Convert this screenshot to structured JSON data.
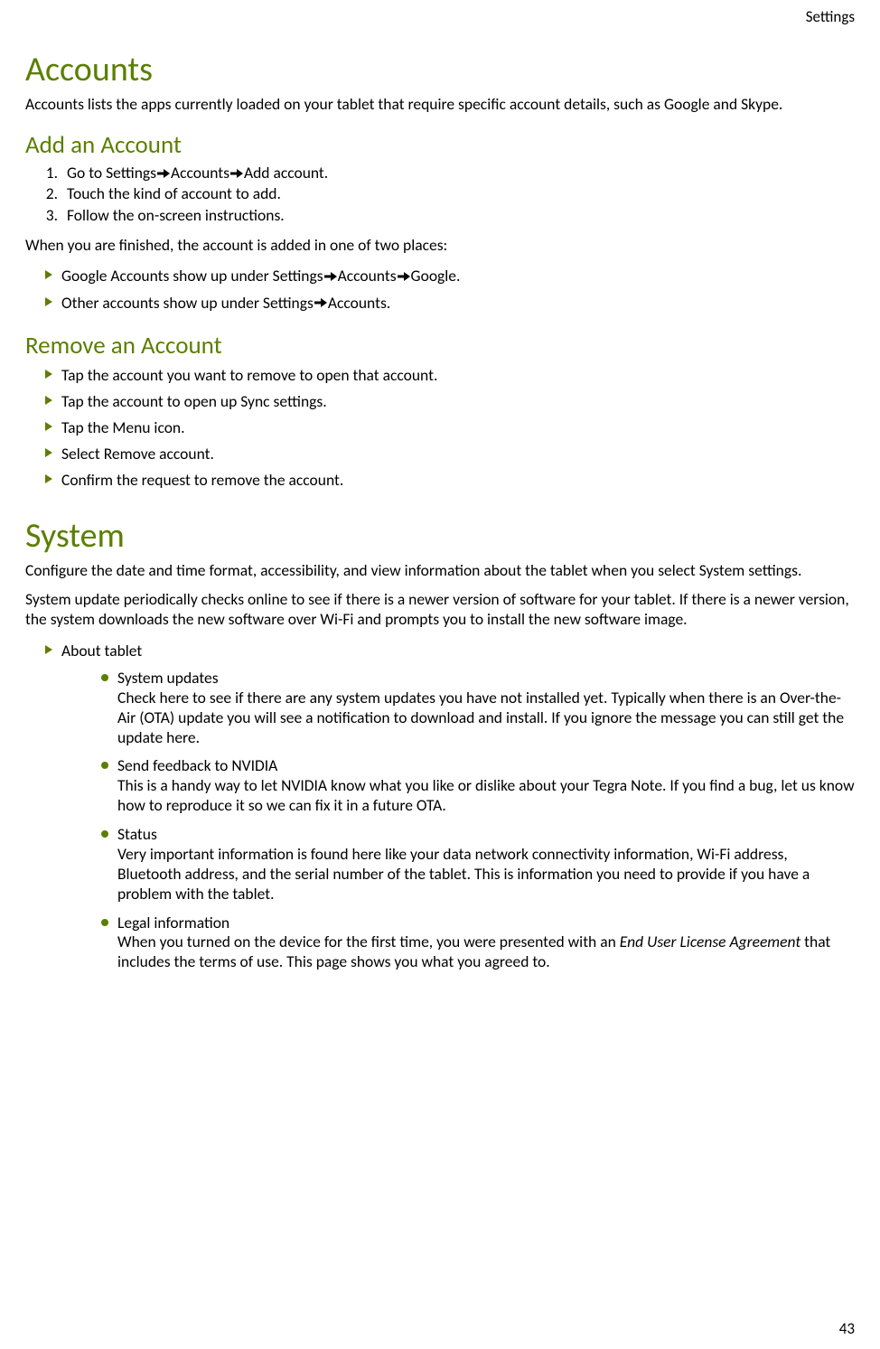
{
  "header": {
    "right": "Settings"
  },
  "accounts": {
    "title": "Accounts",
    "intro": "Accounts lists the apps currently loaded on your tablet that require specific account details, such as Google and Skype.",
    "add": {
      "title": "Add an Account",
      "steps_raw": [
        {
          "pre": "Go to Settings",
          "mid": "Accounts",
          "post": "Add account."
        },
        {
          "text": "Touch the kind of account to add."
        },
        {
          "text": "Follow the on-screen instructions."
        }
      ],
      "finished": "When you are finished, the account is added in one of two places:",
      "places": [
        {
          "pre": "Google Accounts show up under Settings",
          "mid": "Accounts",
          "post": "Google."
        },
        {
          "pre": "Other accounts show up under Settings",
          "post": "Accounts."
        }
      ]
    },
    "remove": {
      "title": "Remove an Account",
      "steps": [
        "Tap the account you want to remove to open that account.",
        "Tap the account to open up Sync settings.",
        "Tap the Menu icon.",
        "Select Remove account.",
        "Confirm the request to remove the account."
      ]
    }
  },
  "system": {
    "title": "System",
    "intro1": "Configure the date and time format, accessibility, and view information about the tablet when you select System settings.",
    "intro2": "System update periodically checks online to see if there is a newer version of software for your tablet. If there is a newer version, the system downloads the new software over Wi-Fi and prompts you to install the new software image.",
    "about": {
      "label": "About tablet",
      "items": [
        {
          "title": "System updates",
          "desc": "Check here to see if there are any system updates you have not installed yet. Typically when there is an Over-the-Air (OTA) update you will see a notification to download and install. If you ignore the message you can still get the update here."
        },
        {
          "title": "Send feedback to NVIDIA",
          "desc": "This is a handy way to let NVIDIA know what you like or dislike about your Tegra Note. If you find a bug, let us know how to reproduce it so we can fix it in a future OTA."
        },
        {
          "title": "Status",
          "desc": "Very important information is found here like your data network connectivity information, Wi-Fi address, Bluetooth address, and the serial number of the tablet. This is information you need to provide if you have a problem with the tablet."
        },
        {
          "title": "Legal information",
          "desc_pre": "When you turned on the device for the first time, you were presented with an ",
          "desc_italic": "End User License Agreement",
          "desc_post": " that includes the terms of use. This page shows you what you agreed to."
        }
      ]
    }
  },
  "page_number": "43"
}
